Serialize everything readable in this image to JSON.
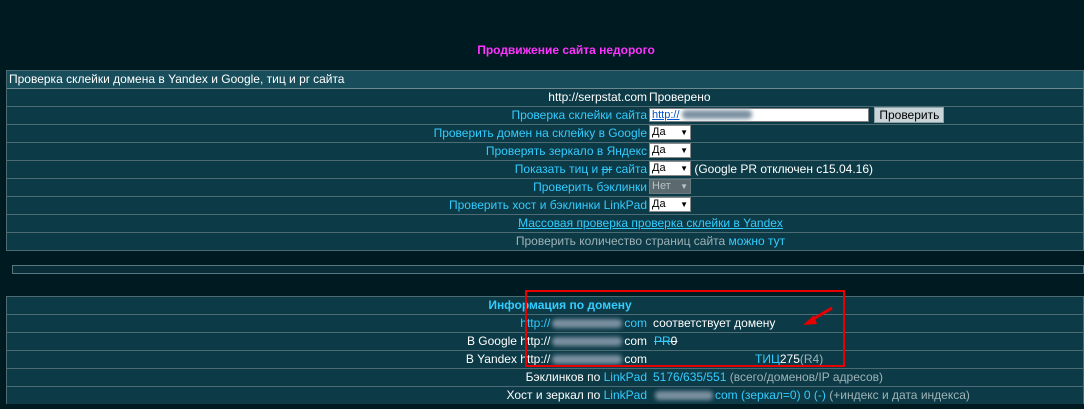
{
  "promo": "Продвижение сайта недорого",
  "form": {
    "title": "Проверка склейки домена в Yandex и Google, тиц и pr сайта",
    "checker_label": "http://serpstat.com",
    "checker_status": "Проверено",
    "check_label": "Проверка склейки сайта",
    "url_value": "http://",
    "check_button": "Проверить",
    "google_label_a": "Проверить домен на склейку в ",
    "google_label_b": "Google",
    "google_value": "Да",
    "yandex_label_a": "Проверять зеркало в ",
    "yandex_label_b": "Яндекс",
    "yandex_value": "Да",
    "tic_label_a": "Показать тиц и ",
    "tic_label_pr": "pr",
    "tic_label_b": " сайта",
    "tic_value": "Да",
    "tic_note": "(Google PR отключен с15.04.16)",
    "backlinks_label": "Проверить бэклинки",
    "backlinks_value": "Нет",
    "linkpad_label_a": "Проверить хост и бэклинки ",
    "linkpad_label_b": "LinkPad",
    "linkpad_value": "Да",
    "mass_link": "Массовая проверка проверка склейки в Yandex",
    "pages_text": "Проверить количество страниц сайта ",
    "pages_link": "можно тут"
  },
  "info": {
    "title": "Информация по домену",
    "domain_prefix": "http://",
    "domain_suffix": "com",
    "domain_match": "соответствует домену",
    "google_label": "В Google http://",
    "google_com": "com",
    "google_pr": "PR",
    "google_pr_value": "0",
    "yandex_label": "В Yandex http://",
    "yandex_com": "com",
    "yandex_tic": "ТИЦ",
    "yandex_tic_value": "275",
    "yandex_r": "(R4)",
    "backlinks_label_a": "Бэклинков по ",
    "backlinks_label_b": "LinkPad",
    "backlinks_value": "5176/635/551",
    "backlinks_note": "(всего/доменов/IP адресов)",
    "host_label_a": "Хост и зеркал по ",
    "host_label_b": "LinkPad",
    "host_value": "com (зеркал=0) 0 (-)",
    "host_note": "(+индекс и дата индекса)"
  },
  "colors": {
    "background": "#001a22",
    "panel": "#0c3a46",
    "accent_link": "#33ccff",
    "promo": "#ff33ff",
    "highlight_box": "#e60000"
  }
}
